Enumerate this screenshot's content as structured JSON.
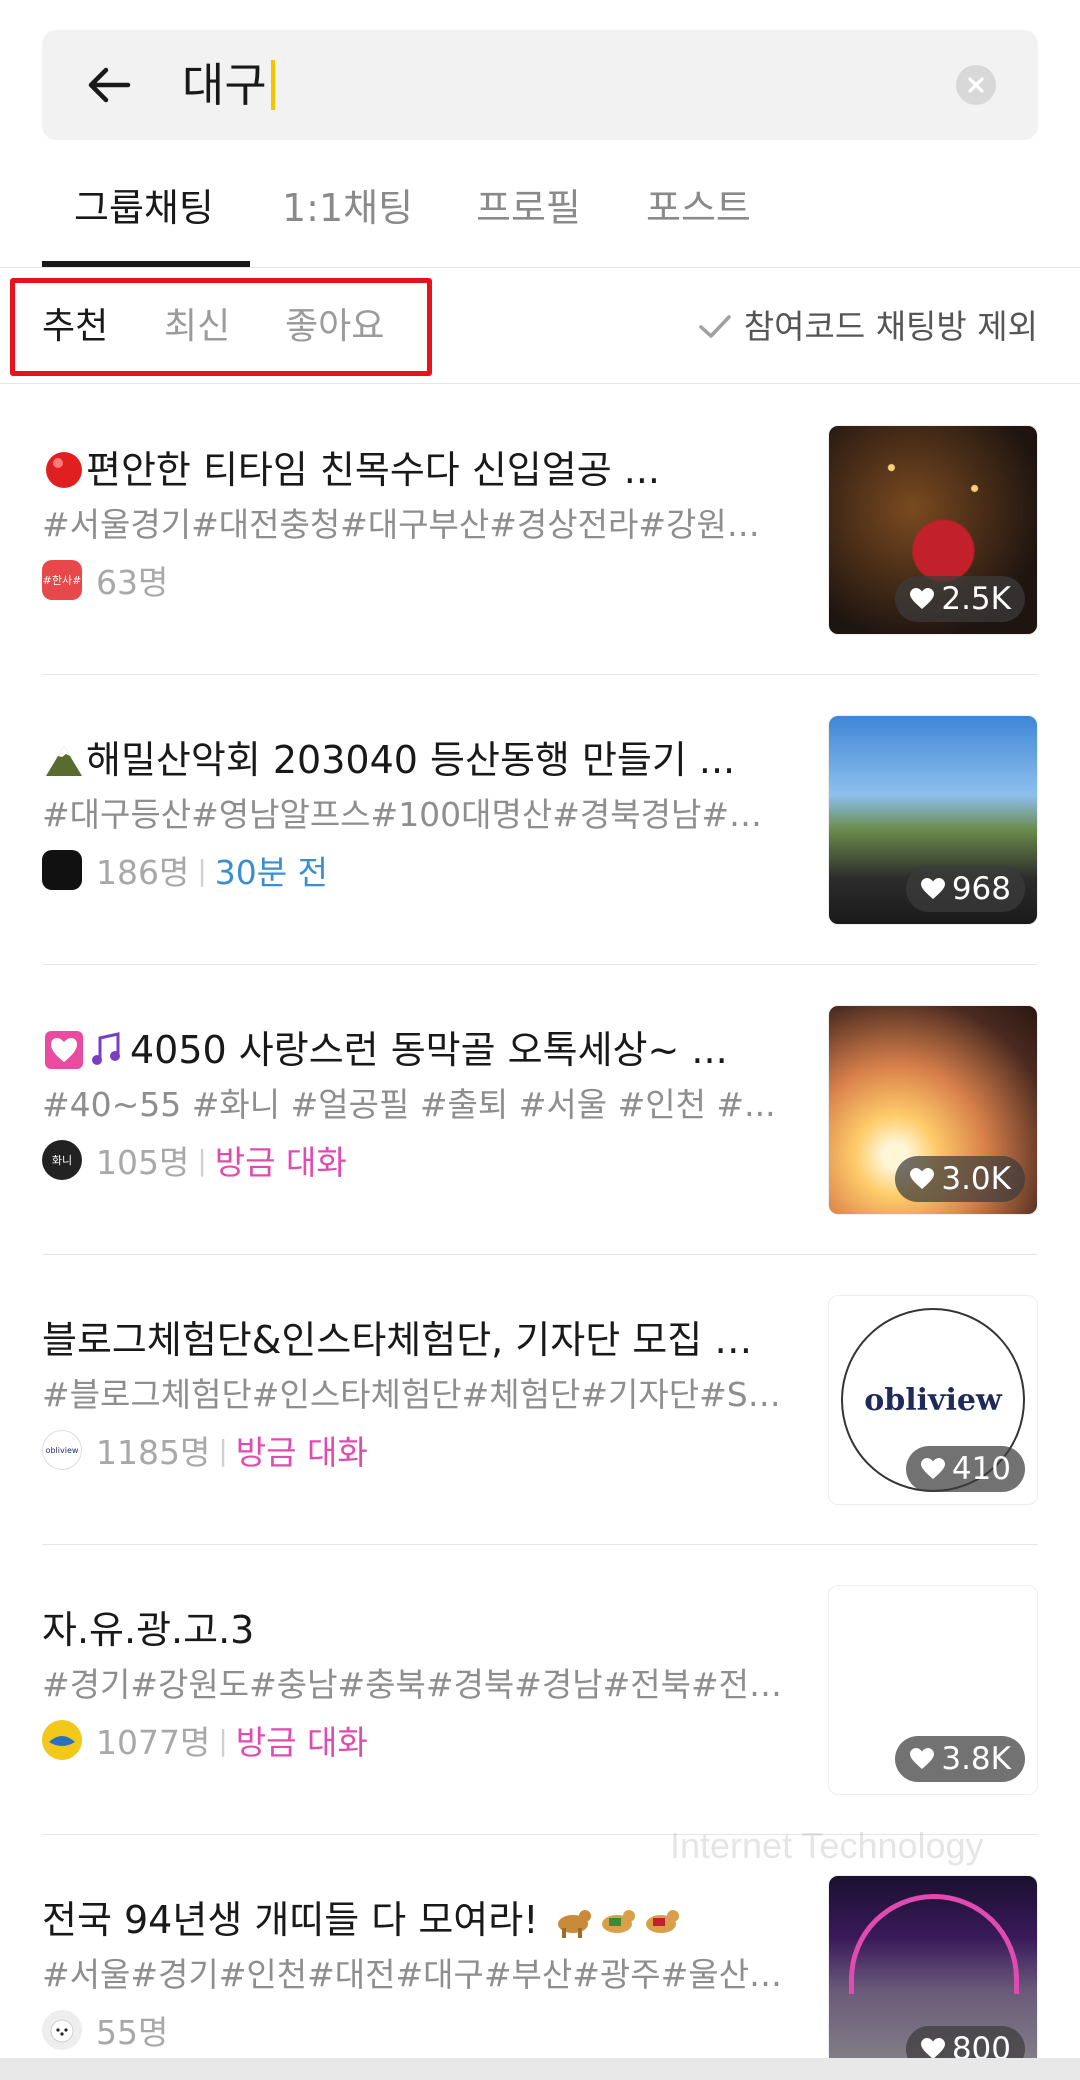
{
  "search": {
    "query": "대구"
  },
  "tabs": [
    {
      "label": "그룹채팅",
      "active": true
    },
    {
      "label": "1:1채팅",
      "active": false
    },
    {
      "label": "프로필",
      "active": false
    },
    {
      "label": "포스트",
      "active": false
    }
  ],
  "sort": {
    "options": [
      {
        "label": "추천",
        "active": true
      },
      {
        "label": "최신",
        "active": false
      },
      {
        "label": "좋아요",
        "active": false
      }
    ],
    "exclude_label": "참여코드 채팅방 제외"
  },
  "rooms": [
    {
      "title": "편안한 티타임 친목수다 신입얼공 ...",
      "tags": "#서울경기#대전충청#대구부산#경상전라#강원제...",
      "members": "63명",
      "activity": "",
      "likes": "2.5K",
      "avatar_text": "#한사#"
    },
    {
      "title": "해밀산악회 203040 등산동행 만들기 ...",
      "tags": "#대구등산#영남알프스#100대명산#경북경남#구...",
      "members": "186명",
      "activity": "30분 전",
      "likes": "968",
      "avatar_text": ""
    },
    {
      "title": "4050 사랑스런 동막골 오톡세상~ ...",
      "tags": "#40~55 #화니 #얼공필 #출퇴 #서울 #인천 #...",
      "members": "105명",
      "activity": "방금 대화",
      "likes": "3.0K",
      "avatar_text": "화니"
    },
    {
      "title": "블로그체험단&인스타체험단, 기자단 모집 전...",
      "tags": "#블로그체험단#인스타체험단#체험단#기자단#SN...",
      "members": "1185명",
      "activity": "방금 대화",
      "likes": "410",
      "avatar_text": "obliview",
      "thumb_text": "obliview"
    },
    {
      "title": "자.유.광.고.3",
      "tags": "#경기#강원도#충남#충북#경북#경남#전북#전남...",
      "members": "1077명",
      "activity": "방금 대화",
      "likes": "3.8K",
      "avatar_text": ""
    },
    {
      "title": "전국 94년생 개띠들 다 모여라! ",
      "tags": "#서울#경기#인천#대전#대구#부산#광주#울산#9...",
      "members": "55명",
      "activity": "",
      "likes": "800",
      "avatar_text": ""
    }
  ],
  "watermark": {
    "text": "Internet Technology"
  },
  "colors": {
    "accent_caret": "#f5c400",
    "activity_blue": "#3b8fd0",
    "activity_pink": "#e04bb0",
    "highlight_red": "#e8111c"
  }
}
